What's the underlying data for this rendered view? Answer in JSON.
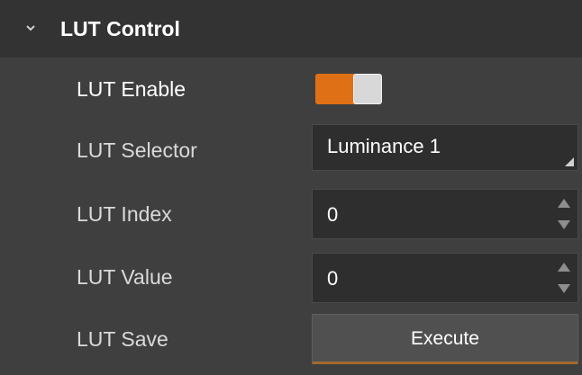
{
  "section": {
    "title": "LUT Control"
  },
  "rows": {
    "enable": {
      "label": "LUT Enable",
      "state": "on",
      "accent": "#e07016"
    },
    "selector": {
      "label": "LUT Selector",
      "value": "Luminance 1"
    },
    "index": {
      "label": "LUT Index",
      "value": "0"
    },
    "value": {
      "label": "LUT Value",
      "value": "0"
    },
    "save": {
      "label": "LUT Save",
      "button_label": "Execute"
    }
  },
  "icons": {
    "collapse": "chevron-down-icon",
    "spin_up": "spin-up-icon",
    "spin_down": "spin-down-icon",
    "dropdown": "dropdown-corner-icon"
  }
}
